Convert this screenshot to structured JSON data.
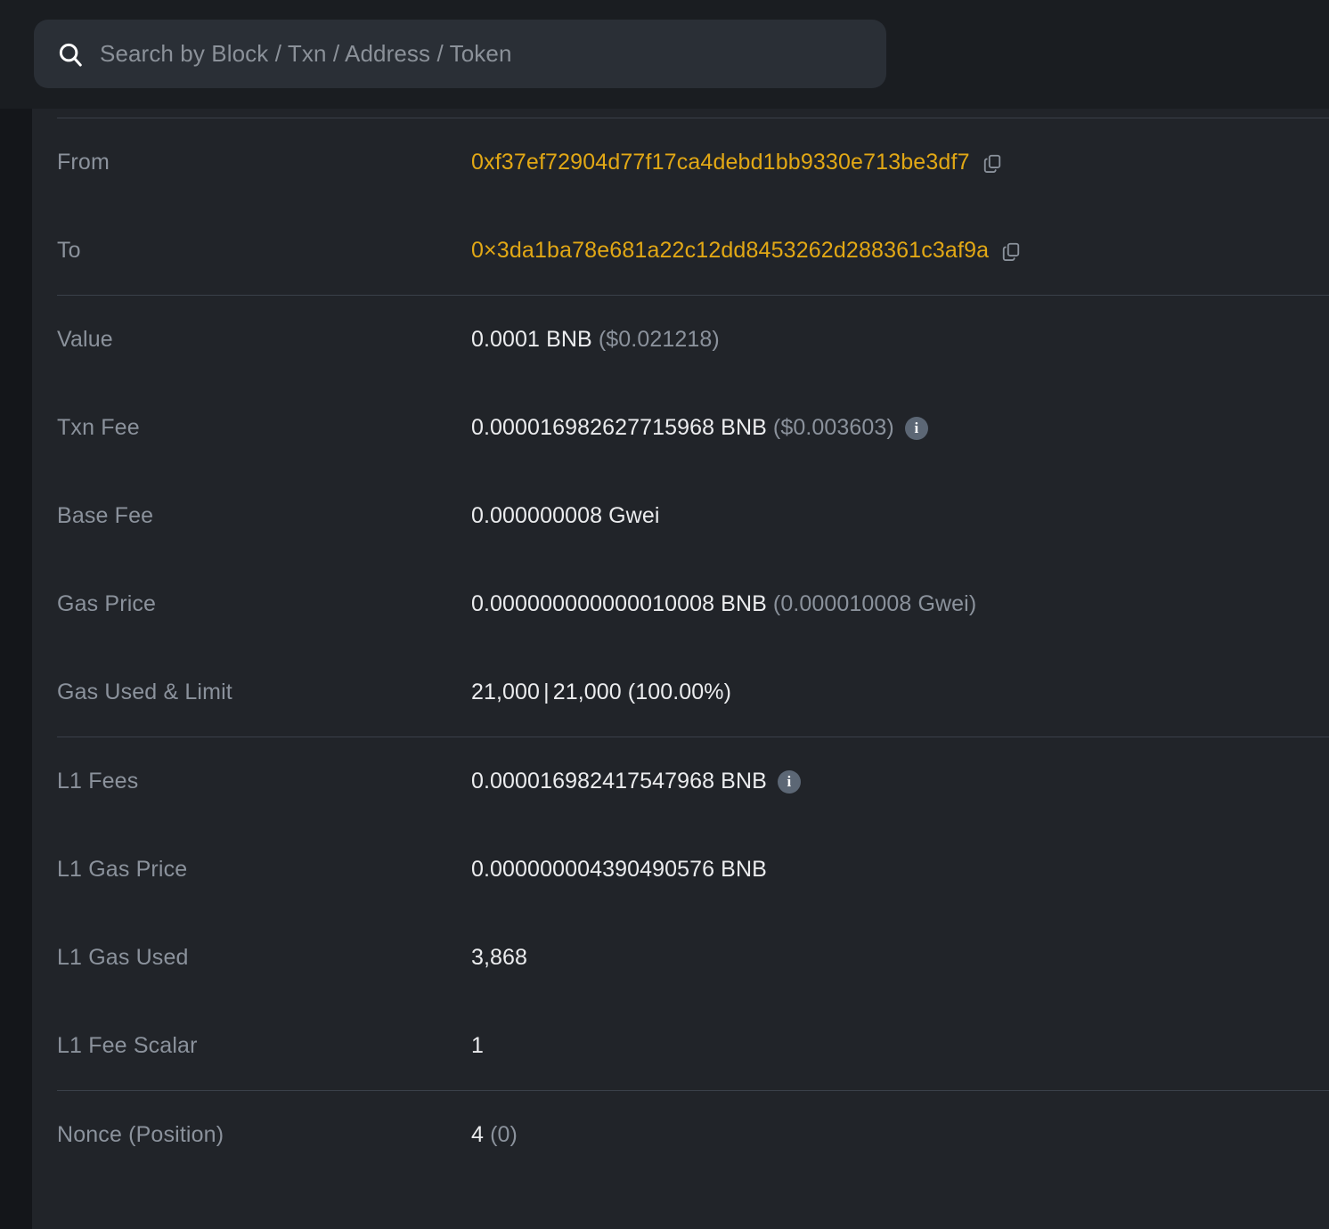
{
  "search": {
    "placeholder": "Search by Block / Txn / Address / Token",
    "value": "",
    "icon": "search-icon"
  },
  "colors": {
    "page_background": "#14161a",
    "card_background": "#212429",
    "header_background": "#1a1d21",
    "search_background": "#2a2f36",
    "address_link": "#e2a815",
    "label_text": "#8b929c",
    "value_text": "#ebecee",
    "divider": "#3a4049",
    "info_badge": "#5c6775"
  },
  "transaction": {
    "groups": [
      {
        "rows": [
          {
            "label": "From",
            "type": "address",
            "address": "0xf37ef72904d77f17ca4debd1bb9330e713be3df7",
            "copy_icon": "copy-icon"
          },
          {
            "label": "To",
            "type": "address",
            "address": "0×3da1ba78e681a22c12dd8453262d288361c3af9a",
            "copy_icon": "copy-icon"
          }
        ]
      },
      {
        "rows": [
          {
            "label": "Value",
            "type": "value_usd",
            "main": "0.0001 BNB",
            "secondary": "($0.021218)"
          },
          {
            "label": "Txn Fee",
            "type": "value_usd_info",
            "main": "0.000016982627715968 BNB",
            "secondary": "($0.003603)",
            "info_icon": "info-icon"
          },
          {
            "label": "Base Fee",
            "type": "plain",
            "main": "0.000000008 Gwei"
          },
          {
            "label": "Gas Price",
            "type": "value_usd",
            "main": "0.000000000000010008 BNB",
            "secondary": "(0.000010008 Gwei)"
          },
          {
            "label": "Gas Used & Limit",
            "type": "gas_pair",
            "used": "21,000",
            "divider": "|",
            "limit": "21,000 (100.00%)"
          }
        ]
      },
      {
        "rows": [
          {
            "label": "L1 Fees",
            "type": "value_info",
            "main": "0.000016982417547968 BNB",
            "info_icon": "info-icon"
          },
          {
            "label": "L1 Gas Price",
            "type": "plain",
            "main": "0.000000004390490576 BNB"
          },
          {
            "label": "L1 Gas Used",
            "type": "plain",
            "main": "3,868"
          },
          {
            "label": "L1 Fee Scalar",
            "type": "plain",
            "main": "1"
          }
        ]
      },
      {
        "rows": [
          {
            "label": "Nonce (Position)",
            "type": "value_usd",
            "main": "4",
            "secondary": "(0)"
          }
        ]
      }
    ]
  }
}
